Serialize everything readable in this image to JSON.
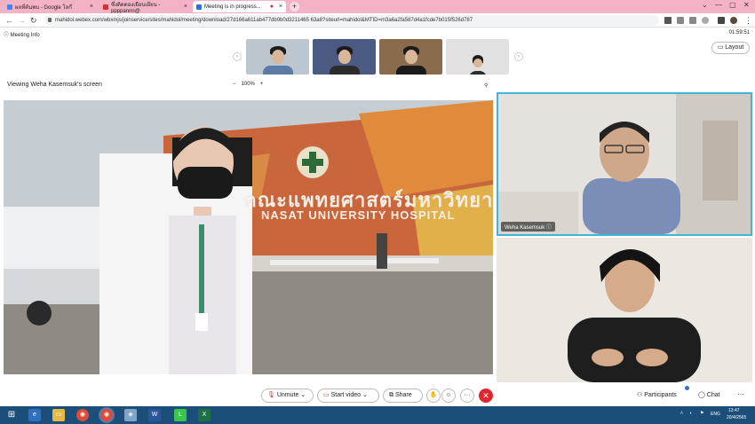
{
  "browser": {
    "tabs": [
      {
        "title": "ผลที่ค้นพบ - Google โลก๊",
        "color": "#4285f4"
      },
      {
        "title": "ซึ่งติดตองเยือนเยียน - ppppannn@",
        "color": "#d93025"
      },
      {
        "title": "Meeting is in progress...",
        "color": "#2a6fdb"
      }
    ],
    "url": "mahidol.webex.com/wbxmjs/joinservice/sites/mahidol/meeting/download/27d166a611ab477db0b0d3211465 63a8?siteurl=mahidol&MTID=m3a6a2fa587d4a1fcde7b015f526d787"
  },
  "meeting": {
    "info_label": "Meeting Info",
    "timer": "01:59:51",
    "layout_label": "Layout",
    "viewing_label": "Viewing Weha Kasemsuk's screen",
    "zoom_level": "100%",
    "speaker_name": "Weha Kasemsuk",
    "thumbnails": [
      {
        "bg": "#bcc6cf",
        "body": "#5a7ba6"
      },
      {
        "bg": "#4a5a82",
        "body": "#2b2b2b"
      },
      {
        "bg": "#8a6b4c",
        "body": "#1a1a1a"
      },
      {
        "bg": "#e1e1e1",
        "body": "#2c2c2c"
      }
    ]
  },
  "shared_screen": {
    "sign_text": "คณะแพทยศาสตร์มหาวิทยาลัยธรรมศาสตร์",
    "sign_sub": "NASAT UNIVERSITY HOSPITAL"
  },
  "controls": {
    "unmute": "Unmute",
    "start_video": "Start video",
    "share": "Share",
    "more": "···",
    "participants": "Participants",
    "chat": "Chat"
  },
  "taskbar": {
    "lang": "ENG",
    "time": "13:47",
    "date": "20/4/2565"
  }
}
